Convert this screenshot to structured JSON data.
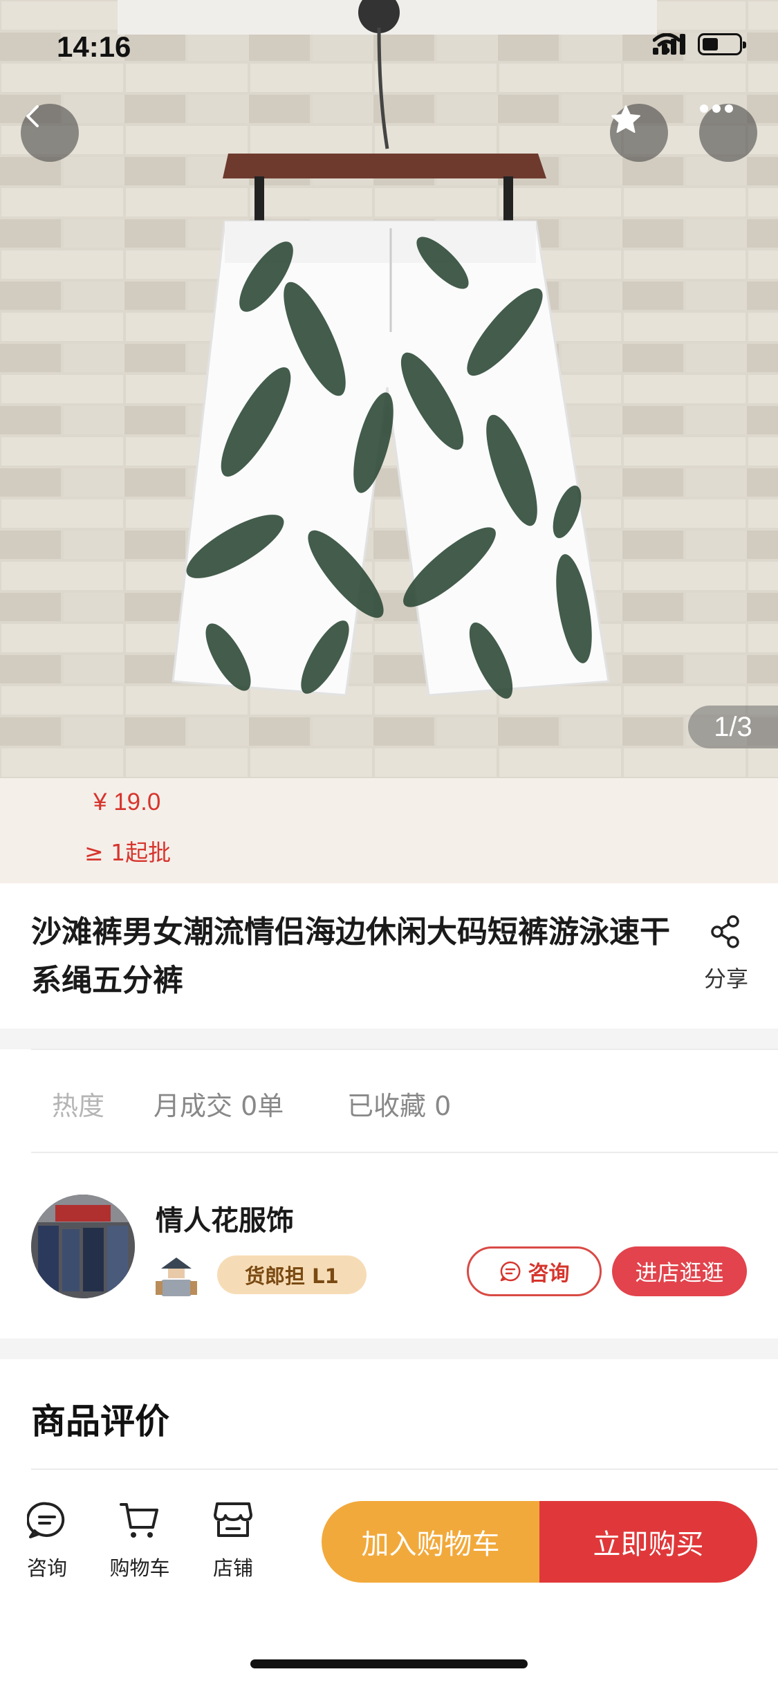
{
  "status_bar": {
    "time": "14:16"
  },
  "gallery": {
    "counter": "1/3"
  },
  "price_section": {
    "price": "¥ 19.0",
    "min_order": "≥ 1起批"
  },
  "product": {
    "title": "沙滩裤男女潮流情侣海边休闲大码短裤游泳速干系绳五分裤",
    "share_label": "分享"
  },
  "stats": {
    "hot_label": "热度",
    "monthly": "月成交 0单",
    "collected": "已收藏 0"
  },
  "shop": {
    "name": "情人花服饰",
    "level_badge": "货郎担 L1",
    "consult_label": "咨询",
    "enter_label": "进店逛逛"
  },
  "reviews": {
    "title": "商品评价"
  },
  "bottom_bar": {
    "tabs": [
      {
        "label": "咨询",
        "icon": "chat-icon"
      },
      {
        "label": "购物车",
        "icon": "cart-icon"
      },
      {
        "label": "店铺",
        "icon": "store-icon"
      }
    ],
    "add_cart_label": "加入购物车",
    "buy_now_label": "立即购买"
  },
  "colors": {
    "accent_red": "#e0383a",
    "accent_orange": "#f2a93b",
    "price_red": "#d6352d",
    "badge_bg": "#f6dcb6"
  }
}
